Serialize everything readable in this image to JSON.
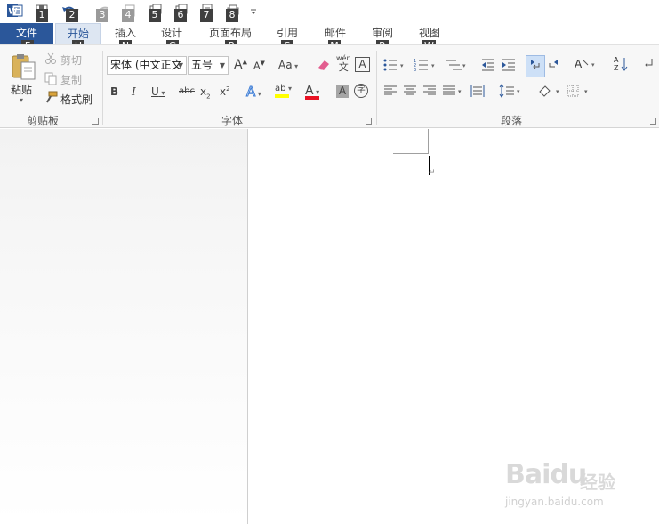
{
  "quick_access": {
    "keytips": [
      "1",
      "2",
      "3",
      "4",
      "5",
      "6",
      "7",
      "8"
    ]
  },
  "tabs": [
    {
      "label": "文件",
      "keytip": "F"
    },
    {
      "label": "开始",
      "keytip": "H"
    },
    {
      "label": "插入",
      "keytip": "N"
    },
    {
      "label": "设计",
      "keytip": "G"
    },
    {
      "label": "页面布局",
      "keytip": "P"
    },
    {
      "label": "引用",
      "keytip": "S"
    },
    {
      "label": "邮件",
      "keytip": "M"
    },
    {
      "label": "审阅",
      "keytip": "R"
    },
    {
      "label": "视图",
      "keytip": "W"
    }
  ],
  "clipboard": {
    "paste": "粘贴",
    "cut": "剪切",
    "copy": "复制",
    "format_painter": "格式刷",
    "group_label": "剪贴板"
  },
  "font": {
    "font_name": "宋体 (中文正文",
    "font_size": "五号",
    "grow": "A",
    "shrink": "A",
    "change_case": "Aa",
    "phonetic": "wén",
    "phonetic_char": "文",
    "char_border": "A",
    "bold": "B",
    "italic": "I",
    "underline": "U",
    "strikethrough": "abc",
    "subscript": "x",
    "subscript_mark": "2",
    "superscript": "x",
    "superscript_mark": "2",
    "text_effects": "A",
    "highlight": "ab",
    "font_color": "A",
    "char_shading": "A",
    "enclose_char": "字",
    "group_label": "字体"
  },
  "paragraph": {
    "sort": "A",
    "sort_z": "Z",
    "group_label": "段落"
  },
  "watermark": {
    "logo": "Baidu",
    "text": "经验",
    "url": "jingyan.baidu.com"
  },
  "colors": {
    "file_tab": "#2b579a",
    "highlight_yellow": "#ffff00",
    "font_red": "#e81123"
  }
}
